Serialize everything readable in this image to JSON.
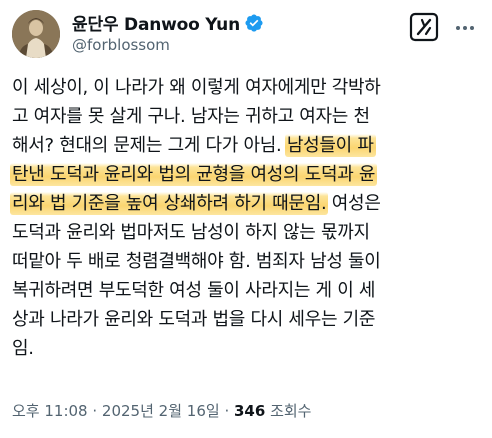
{
  "author": {
    "display_name": "윤단우 Danwoo Yun",
    "handle": "@forblossom",
    "verified": true,
    "verified_color": "#1d9bf0"
  },
  "actions": {
    "grok_icon": "grok-icon",
    "more_icon": "more-horizontal-icon"
  },
  "tweet": {
    "lines": [
      {
        "before": "이 세상이, 이 나라가 왜 이렇게 여자에게만 각박하",
        "highlight": "",
        "after": ""
      },
      {
        "before": "고 여자를 못 살게 구나. 남자는 귀하고 여자는 천",
        "highlight": "",
        "after": ""
      },
      {
        "before": "해서? 현대의 문제는 그게 다가 아님. ",
        "highlight": "남성들이 파",
        "after": ""
      },
      {
        "before": "",
        "highlight": "탄낸 도덕과 윤리와 법의 균형을 여성의 도덕과 윤",
        "after": ""
      },
      {
        "before": "",
        "highlight": "리와 법 기준을 높여 상쇄하려 하기 때문임.",
        "after": " 여성은"
      },
      {
        "before": "도덕과 윤리와 법마저도 남성이 하지 않는 몫까지",
        "highlight": "",
        "after": ""
      },
      {
        "before": "떠맡아 두 배로 청렴결백해야 함. 범죄자 남성 둘이",
        "highlight": "",
        "after": ""
      },
      {
        "before": "복귀하려면 부도덕한 여성 둘이 사라지는 게 이 세",
        "highlight": "",
        "after": ""
      },
      {
        "before": "상과 나라가 윤리와 도덕과 법을 다시 세우는 기준",
        "highlight": "",
        "after": ""
      },
      {
        "before": "임.",
        "highlight": "",
        "after": ""
      }
    ],
    "highlight_color": "#f9cf58"
  },
  "meta": {
    "time": "오후 11:08",
    "separator": " · ",
    "date": "2025년 2월 16일",
    "separator2": " · ",
    "views_count": "346",
    "views_label": " 조회수"
  }
}
